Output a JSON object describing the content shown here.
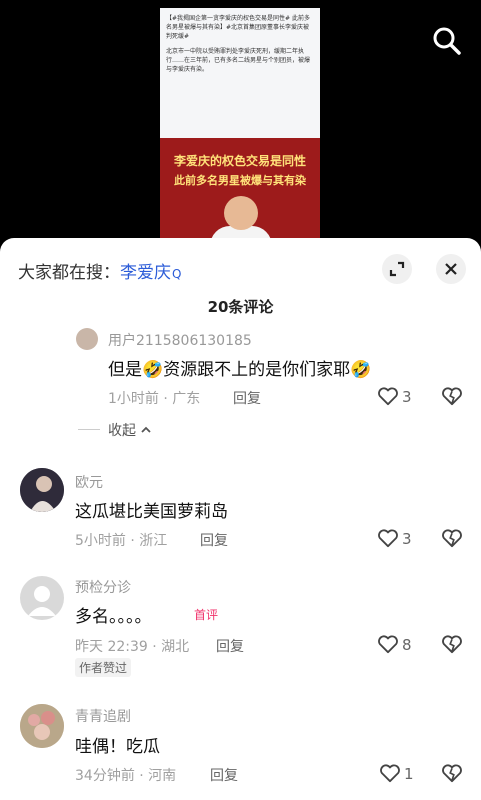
{
  "video": {
    "article_title": "【#我揭国企第一贪李爱庆的权色交易是同性# 此前多名男星被爆与其有染】#北京首集团原董事长李爱庆被判死缓#",
    "article_body": "北京市一中院以受贿罪判处李爱庆死刑，缓期二年执行……在三年前，已有多名二线男星与个别团员，被爆与李爱庆有染。",
    "banner_line1": "李爱庆的权色交易是同性",
    "banner_line2": "此前多名男星被爆与其有染"
  },
  "header": {
    "prefix": "大家都在搜：",
    "keyword": "李爱庆",
    "search_suffix": "Q"
  },
  "comment_count": "20条评论",
  "collapse_label": "收起",
  "comments": [
    {
      "name": "用户2115806130185",
      "content": "但是🤣资源跟不上的是你们家耶🤣",
      "meta": "1小时前 · 广东",
      "reply": "回复",
      "likes": "3"
    },
    {
      "name": "欧元",
      "content": "这瓜堪比美国萝莉岛",
      "meta": "5小时前 · 浙江",
      "reply": "回复",
      "likes": "3"
    },
    {
      "name": "预检分诊",
      "content": "多名。。。。",
      "tag": "首评",
      "meta": "昨天 22:39 · 湖北",
      "reply": "回复",
      "likes": "8",
      "badge": "作者赞过"
    },
    {
      "name": "青青追剧",
      "content": "哇偶！吃瓜",
      "meta": "34分钟前 · 河南",
      "reply": "回复",
      "likes": "1"
    }
  ],
  "colors": {
    "keyword": "#2c5cd8",
    "first_comment_tag": "#f0326b"
  }
}
